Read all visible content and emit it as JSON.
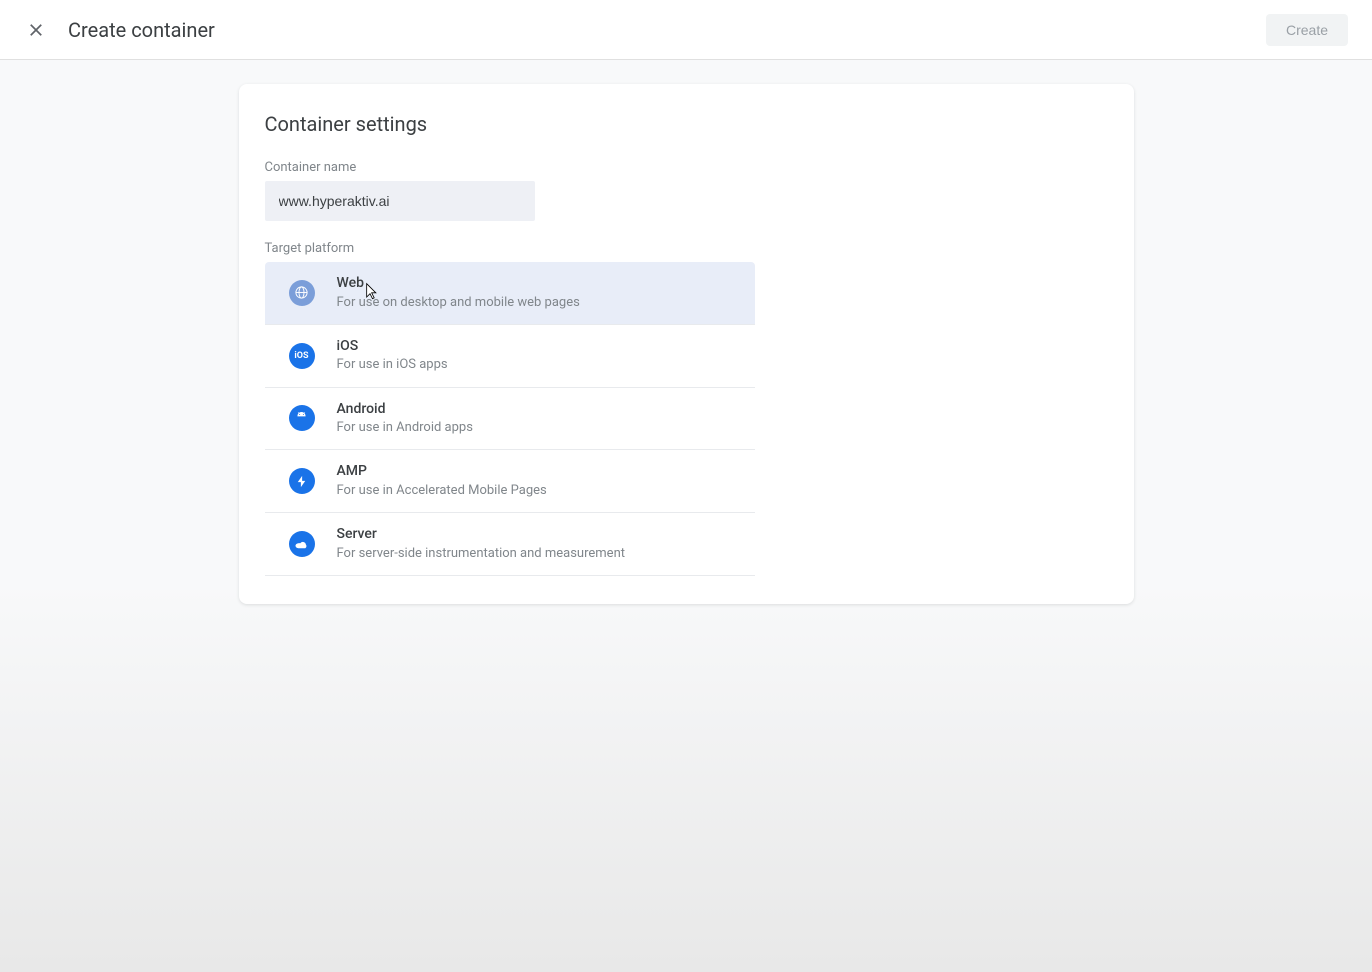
{
  "header": {
    "title": "Create container",
    "create_label": "Create"
  },
  "card": {
    "title": "Container settings",
    "container_name_label": "Container name",
    "container_name_value": "www.hyperaktiv.ai",
    "target_platform_label": "Target platform"
  },
  "platforms": [
    {
      "name": "Web",
      "desc": "For use on desktop and mobile web pages",
      "selected": true
    },
    {
      "name": "iOS",
      "desc": "For use in iOS apps",
      "selected": false
    },
    {
      "name": "Android",
      "desc": "For use in Android apps",
      "selected": false
    },
    {
      "name": "AMP",
      "desc": "For use in Accelerated Mobile Pages",
      "selected": false
    },
    {
      "name": "Server",
      "desc": "For server-side instrumentation and measurement",
      "selected": false
    }
  ]
}
